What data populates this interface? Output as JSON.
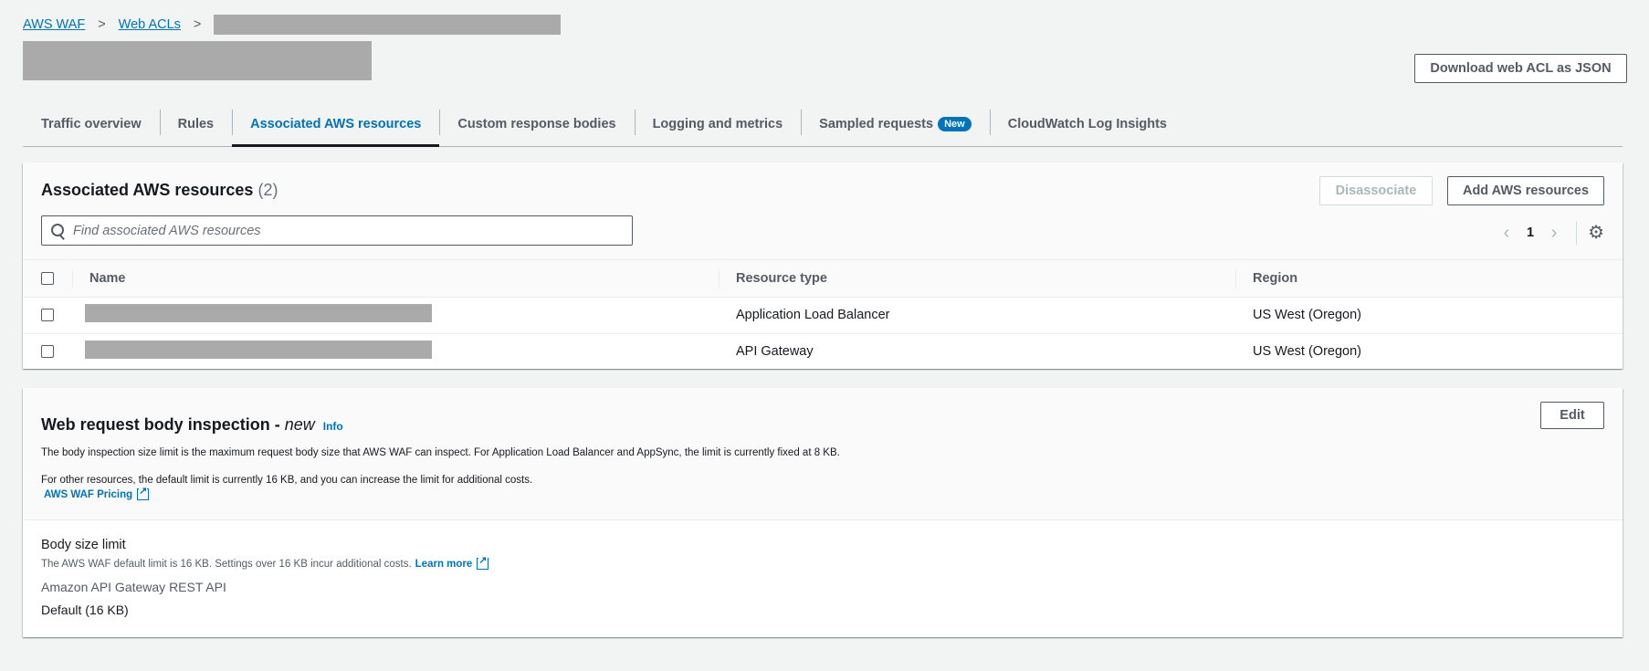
{
  "breadcrumb": {
    "item1": "AWS WAF",
    "item2": "Web ACLs",
    "separator": ">"
  },
  "header": {
    "download_button": "Download web ACL as JSON"
  },
  "tabs": [
    {
      "label": "Traffic overview"
    },
    {
      "label": "Rules"
    },
    {
      "label": "Associated AWS resources",
      "active": true
    },
    {
      "label": "Custom response bodies"
    },
    {
      "label": "Logging and metrics"
    },
    {
      "label": "Sampled requests",
      "badge": "New"
    },
    {
      "label": "CloudWatch Log Insights"
    }
  ],
  "resources": {
    "title": "Associated AWS resources",
    "count": "(2)",
    "disassociate_button": "Disassociate",
    "add_button": "Add AWS resources",
    "search_placeholder": "Find associated AWS resources",
    "pagination": {
      "current_page": "1"
    },
    "columns": {
      "name": "Name",
      "type": "Resource type",
      "region": "Region"
    },
    "rows": [
      {
        "type": "Application Load Balancer",
        "region": "US West (Oregon)"
      },
      {
        "type": "API Gateway",
        "region": "US West (Oregon)"
      }
    ]
  },
  "body_inspection": {
    "title": "Web request body inspection - ",
    "title_emphasis": "new",
    "info_link": "Info",
    "edit_button": "Edit",
    "description1": "The body inspection size limit is the maximum request body size that AWS WAF can inspect. For Application Load Balancer and AppSync, the limit is currently fixed at 8 KB.",
    "description2": "For other resources, the default limit is currently 16 KB, and you can increase the limit for additional costs.",
    "pricing_link": "AWS WAF Pricing",
    "body_size_label": "Body size limit",
    "body_size_desc": "The AWS WAF default limit is 16 KB. Settings over 16 KB incur additional costs.",
    "learn_more": "Learn more",
    "api_label": "Amazon API Gateway REST API",
    "default_value": "Default (16 KB)"
  },
  "colors": {
    "link": "#0073bb",
    "background": "#f2f3f3",
    "text": "#16191f",
    "badge": "#0073bb"
  }
}
